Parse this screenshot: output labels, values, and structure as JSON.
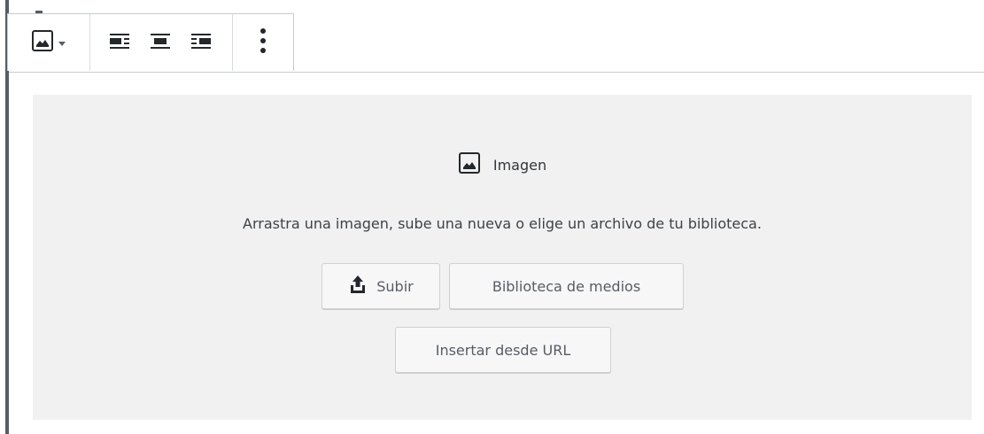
{
  "toolbar": {
    "block_type": {
      "icon": "image-icon",
      "dropdown_icon": "caret-down-icon"
    },
    "alignment": [
      {
        "icon": "align-left-icon"
      },
      {
        "icon": "align-center-icon"
      },
      {
        "icon": "align-right-icon"
      }
    ],
    "more": {
      "icon": "more-options-icon"
    }
  },
  "placeholder": {
    "title": "Imagen",
    "title_icon": "image-icon",
    "instructions": "Arrastra una imagen, sube una nueva o elige un archivo de tu biblioteca.",
    "upload_label": "Subir",
    "upload_icon": "upload-icon",
    "library_label": "Biblioteca de medios",
    "url_label": "Insertar desde URL"
  },
  "colors": {
    "background": "#ffffff",
    "placeholder_bg": "#f1f1f1",
    "border": "#c8ccd0",
    "icon": "#23282d",
    "text": "#3c434a",
    "button_bg": "#f7f7f7"
  }
}
